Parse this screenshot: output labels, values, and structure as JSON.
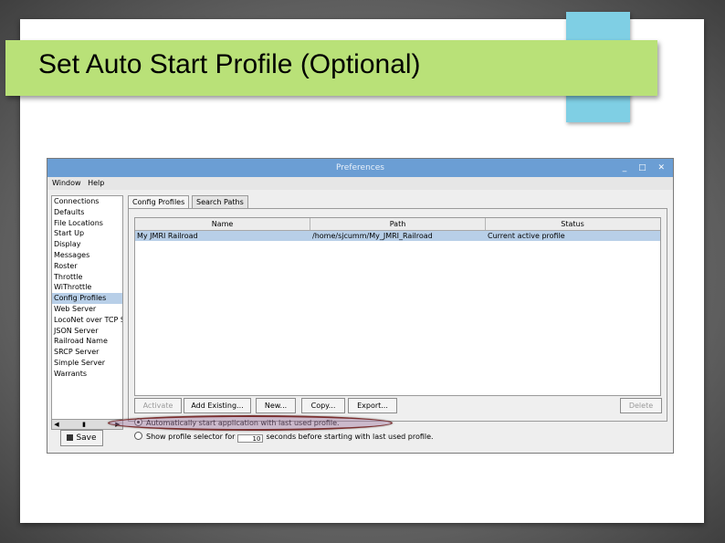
{
  "slide": {
    "title": "Set Auto Start Profile (Optional)"
  },
  "window": {
    "title": "Preferences",
    "controls": "_ □ ✕",
    "menu": [
      "Window",
      "Help"
    ],
    "nav_items": [
      "Connections",
      "Defaults",
      "File Locations",
      "Start Up",
      "Display",
      "Messages",
      "Roster",
      "Throttle",
      "WiThrottle",
      "Config Profiles",
      "Web Server",
      "LocoNet over TCP S",
      "JSON Server",
      "Railroad Name",
      "SRCP Server",
      "Simple Server",
      "Warrants"
    ],
    "nav_selected": "Config Profiles",
    "save_label": "Save",
    "tabs": [
      "Config Profiles",
      "Search Paths"
    ],
    "table": {
      "columns": [
        "Name",
        "Path",
        "Status"
      ],
      "rows": [
        [
          "My JMRI Railroad",
          "/home/sjcumm/My_JMRI_Railroad",
          "Current active profile"
        ]
      ]
    },
    "buttons": {
      "activate": "Activate",
      "add_existing": "Add Existing...",
      "new": "New...",
      "copy": "Copy...",
      "export": "Export...",
      "delete": "Delete"
    },
    "options": {
      "auto_start": "Automatically start application with last used profile.",
      "show_selector_prefix": "Show profile selector for",
      "show_selector_value": "10",
      "show_selector_suffix": "seconds before starting with last used profile."
    }
  },
  "colors": {
    "title_bar": "#b9e178",
    "accent": "#7fcfe4",
    "window_titlebar": "#6b9ed4",
    "selection": "#b8cfe8",
    "highlight_ring": "#7a2f2f"
  }
}
